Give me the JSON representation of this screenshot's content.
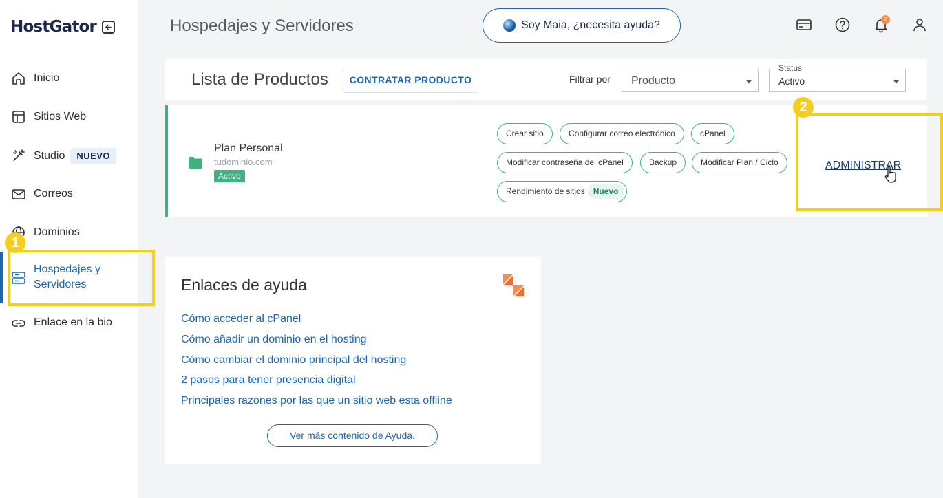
{
  "app": {
    "logo": "HostGator"
  },
  "sidebar": {
    "items": [
      {
        "label": "Inicio",
        "icon": "home-icon"
      },
      {
        "label": "Sitios Web",
        "icon": "layout-icon"
      },
      {
        "label": "Studio",
        "icon": "magic-wand-icon",
        "badge": "NUEVO"
      },
      {
        "label": "Correos",
        "icon": "mail-icon"
      },
      {
        "label": "Dominios",
        "icon": "globe-icon"
      },
      {
        "label": "Hospedajes y",
        "label2": "Servidores",
        "icon": "server-icon",
        "active": true
      },
      {
        "label": "Enlace en la bio",
        "icon": "link-icon"
      }
    ]
  },
  "header": {
    "title": "Hospedajes y Servidores",
    "maia_label": "Soy Maia, ¿necesita ayuda?",
    "notification_count": "2"
  },
  "products": {
    "title": "Lista de Productos",
    "contract_label": "CONTRATAR PRODUCTO",
    "filter_label": "Filtrar por",
    "filter_select": "Producto",
    "status_label": "Status",
    "status_select": "Activo",
    "plan": {
      "name": "Plan Personal",
      "domain": "tudominio.com",
      "status": "Activo",
      "actions": [
        "Crear sitio",
        "Configurar correo electrónico",
        "cPanel",
        "Modificar contraseña del cPanel",
        "Backup",
        "Modificar Plan / Ciclo",
        "Rendimiento de sitios"
      ],
      "actions_new_badge": "Nuevo",
      "admin_label": "ADMINISTRAR"
    }
  },
  "help": {
    "title": "Enlaces de ayuda",
    "links": [
      "Cómo acceder al cPanel",
      "Cómo añadir un dominio en el hosting",
      "Cómo cambiar el dominio principal del hosting",
      "2 pasos para tener presencia digital",
      "Principales razones por las que un sitio web esta offline"
    ],
    "more_label": "Ver más contenido de Ayuda."
  },
  "annotations": {
    "step1": "1",
    "step2": "2"
  },
  "colors": {
    "accent": "#1a66b5",
    "success": "#3fb37f",
    "highlight": "#f2cf1f"
  }
}
